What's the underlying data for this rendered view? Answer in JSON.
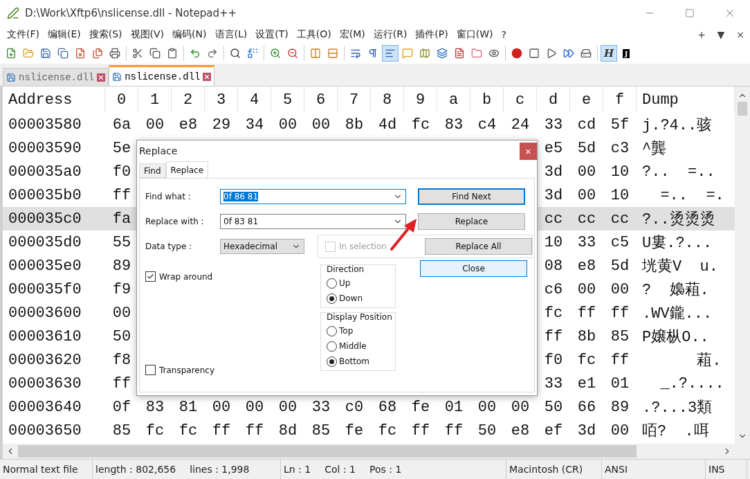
{
  "window": {
    "title": "D:\\Work\\Xftp6\\nslicense.dll - Notepad++"
  },
  "menu": [
    "文件(F)",
    "编辑(E)",
    "搜索(S)",
    "视图(V)",
    "编码(N)",
    "语言(L)",
    "设置(T)",
    "工具(O)",
    "宏(M)",
    "运行(R)",
    "插件(P)",
    "窗口(W)",
    "?"
  ],
  "menu_controls": [
    "+",
    "▼",
    "×"
  ],
  "toolbar": [
    {
      "kind": "new",
      "pressed": false
    },
    {
      "kind": "open",
      "pressed": false
    },
    {
      "kind": "save",
      "pressed": false
    },
    {
      "kind": "save-all",
      "pressed": false
    },
    {
      "kind": "close",
      "pressed": false
    },
    {
      "kind": "close-all",
      "pressed": false
    },
    {
      "kind": "print",
      "pressed": false
    },
    {
      "kind": "separator"
    },
    {
      "kind": "cut",
      "pressed": false
    },
    {
      "kind": "copy",
      "pressed": false
    },
    {
      "kind": "paste",
      "pressed": false
    },
    {
      "kind": "separator"
    },
    {
      "kind": "undo",
      "pressed": false
    },
    {
      "kind": "redo",
      "pressed": false
    },
    {
      "kind": "separator"
    },
    {
      "kind": "find",
      "pressed": false
    },
    {
      "kind": "replace",
      "pressed": false
    },
    {
      "kind": "separator"
    },
    {
      "kind": "zoom-in",
      "pressed": false
    },
    {
      "kind": "zoom-out",
      "pressed": false
    },
    {
      "kind": "separator"
    },
    {
      "kind": "sync-vertical",
      "pressed": false
    },
    {
      "kind": "sync-horizontal",
      "pressed": false
    },
    {
      "kind": "separator"
    },
    {
      "kind": "wrap",
      "pressed": false
    },
    {
      "kind": "all-chars",
      "pressed": false
    },
    {
      "kind": "indent-guide",
      "pressed": true
    },
    {
      "kind": "comment",
      "pressed": false
    },
    {
      "kind": "map",
      "pressed": false
    },
    {
      "kind": "documents",
      "pressed": false
    },
    {
      "kind": "function-list",
      "pressed": false
    },
    {
      "kind": "folder",
      "pressed": false
    },
    {
      "kind": "monitor",
      "pressed": false
    },
    {
      "kind": "separator"
    },
    {
      "kind": "record",
      "pressed": false
    },
    {
      "kind": "stop",
      "pressed": false
    },
    {
      "kind": "play",
      "pressed": false
    },
    {
      "kind": "play-multiple",
      "pressed": false
    },
    {
      "kind": "save-macro",
      "pressed": false
    },
    {
      "kind": "separator"
    },
    {
      "kind": "letter",
      "label": "H",
      "pressed": true
    },
    {
      "kind": "letter-dark",
      "label": "J",
      "pressed": false
    }
  ],
  "tabs": [
    {
      "label": "nslicense.dll",
      "selected": false
    },
    {
      "label": "nslicense.dll",
      "selected": true
    }
  ],
  "hex": {
    "columns": [
      "Address",
      "0",
      "1",
      "2",
      "3",
      "4",
      "5",
      "6",
      "7",
      "8",
      "9",
      "a",
      "b",
      "c",
      "d",
      "e",
      "f",
      "Dump"
    ],
    "rows": [
      {
        "cells": [
          "00003580",
          "6a",
          "00",
          "e8",
          "29",
          "34",
          "00",
          "00",
          "8b",
          "4d",
          "fc",
          "83",
          "c4",
          "24",
          "33",
          "cd",
          "5f",
          "j.?4..骇"
        ],
        "selected": false
      },
      {
        "cells": [
          "00003590",
          "5e",
          "",
          "",
          "",
          "",
          "",
          "",
          "",
          "",
          "",
          "",
          "",
          "",
          "e5",
          "5d",
          "c3",
          "^龔"
        ],
        "selected": false
      },
      {
        "cells": [
          "000035a0",
          "f0",
          "",
          "",
          "",
          "",
          "",
          "",
          "",
          "",
          "",
          "",
          "",
          "",
          "3d",
          "00",
          "10",
          "?..  =.."
        ],
        "selected": false
      },
      {
        "cells": [
          "000035b0",
          "ff",
          "",
          "",
          "",
          "",
          "",
          "",
          "",
          "",
          "",
          "",
          "",
          "",
          "3d",
          "00",
          "10",
          "  =..  =."
        ],
        "selected": false
      },
      {
        "cells": [
          "000035c0",
          "fa",
          "",
          "",
          "",
          "",
          "",
          "",
          "",
          "",
          "",
          "",
          "",
          "",
          "cc",
          "cc",
          "cc",
          "?..烫烫烫"
        ],
        "selected": true
      },
      {
        "cells": [
          "000035d0",
          "55",
          "",
          "",
          "",
          "",
          "",
          "",
          "",
          "",
          "",
          "",
          "",
          "",
          "10",
          "33",
          "c5",
          "U婁.?..."
        ],
        "selected": false
      },
      {
        "cells": [
          "000035e0",
          "89",
          "",
          "",
          "",
          "",
          "",
          "",
          "",
          "",
          "",
          "",
          "",
          "",
          "08",
          "e8",
          "5d",
          "垙黄V  u."
        ],
        "selected": false
      },
      {
        "cells": [
          "000035f0",
          "f9",
          "",
          "",
          "",
          "",
          "",
          "",
          "",
          "",
          "",
          "",
          "",
          "",
          "c6",
          "00",
          "00",
          "?  嬝蒩."
        ],
        "selected": false
      },
      {
        "cells": [
          "00003600",
          "00",
          "",
          "",
          "",
          "",
          "",
          "",
          "",
          "",
          "",
          "",
          "",
          "",
          "fc",
          "ff",
          "ff",
          ".WV鑨..."
        ],
        "selected": false
      },
      {
        "cells": [
          "00003610",
          "50",
          "",
          "",
          "",
          "",
          "",
          "",
          "",
          "",
          "",
          "",
          "",
          "",
          "ff",
          "8b",
          "85",
          "P嬢枞O.."
        ],
        "selected": false
      },
      {
        "cells": [
          "00003620",
          "f8",
          "",
          "",
          "",
          "",
          "",
          "",
          "",
          "",
          "",
          "",
          "",
          "",
          "f0",
          "fc",
          "ff",
          "      蒩."
        ],
        "selected": false
      },
      {
        "cells": [
          "00003630",
          "ff",
          "",
          "",
          "",
          "",
          "",
          "",
          "",
          "",
          "",
          "",
          "",
          "",
          "33",
          "e1",
          "01",
          "  _.?...."
        ],
        "selected": false
      },
      {
        "cells": [
          "00003640",
          "0f",
          "83",
          "81",
          "00",
          "00",
          "00",
          "33",
          "c0",
          "68",
          "fe",
          "01",
          "00",
          "00",
          "50",
          "66",
          "89",
          ".?...3類"
        ],
        "selected": false
      },
      {
        "cells": [
          "00003650",
          "85",
          "fc",
          "fc",
          "ff",
          "ff",
          "8d",
          "85",
          "fe",
          "fc",
          "ff",
          "ff",
          "50",
          "e8",
          "ef",
          "3d",
          "00",
          "咟?  .咡"
        ],
        "selected": false
      }
    ]
  },
  "dialog": {
    "title": "Replace",
    "close": "×",
    "tabs": [
      {
        "label": "Find",
        "selected": false
      },
      {
        "label": "Replace",
        "selected": true
      }
    ],
    "find_what": {
      "label": "Find what :",
      "value": "0f 86 81"
    },
    "replace_with": {
      "label": "Replace with :",
      "value": "0f 83 81"
    },
    "data_type": {
      "label": "Data type :",
      "value": "Hexadecimal"
    },
    "in_selection": {
      "label": "In selection",
      "checked": false,
      "disabled": true
    },
    "wrap_around": {
      "label": "Wrap around",
      "checked": true
    },
    "transparency": {
      "label": "Transparency",
      "checked": false
    },
    "direction": {
      "title": "Direction",
      "options": [
        {
          "label": "Up",
          "selected": false
        },
        {
          "label": "Down",
          "selected": true
        }
      ]
    },
    "display_position": {
      "title": "Display Position",
      "options": [
        {
          "label": "Top",
          "selected": false
        },
        {
          "label": "Middle",
          "selected": false
        },
        {
          "label": "Bottom",
          "selected": true
        }
      ]
    },
    "buttons": [
      {
        "label": "Find Next",
        "kind": "focused"
      },
      {
        "label": "Replace",
        "kind": "normal"
      },
      {
        "label": "Replace All",
        "kind": "normal"
      },
      {
        "label": "Close",
        "kind": "default"
      }
    ]
  },
  "status_bar": {
    "file_type": "Normal text file",
    "length": "length : 802,656",
    "lines": "lines : 1,998",
    "ln": "Ln : 1",
    "col": "Col : 1",
    "pos": "Pos : 1",
    "eol": "Macintosh (CR)",
    "encoding": "ANSI",
    "mode": "INS"
  }
}
